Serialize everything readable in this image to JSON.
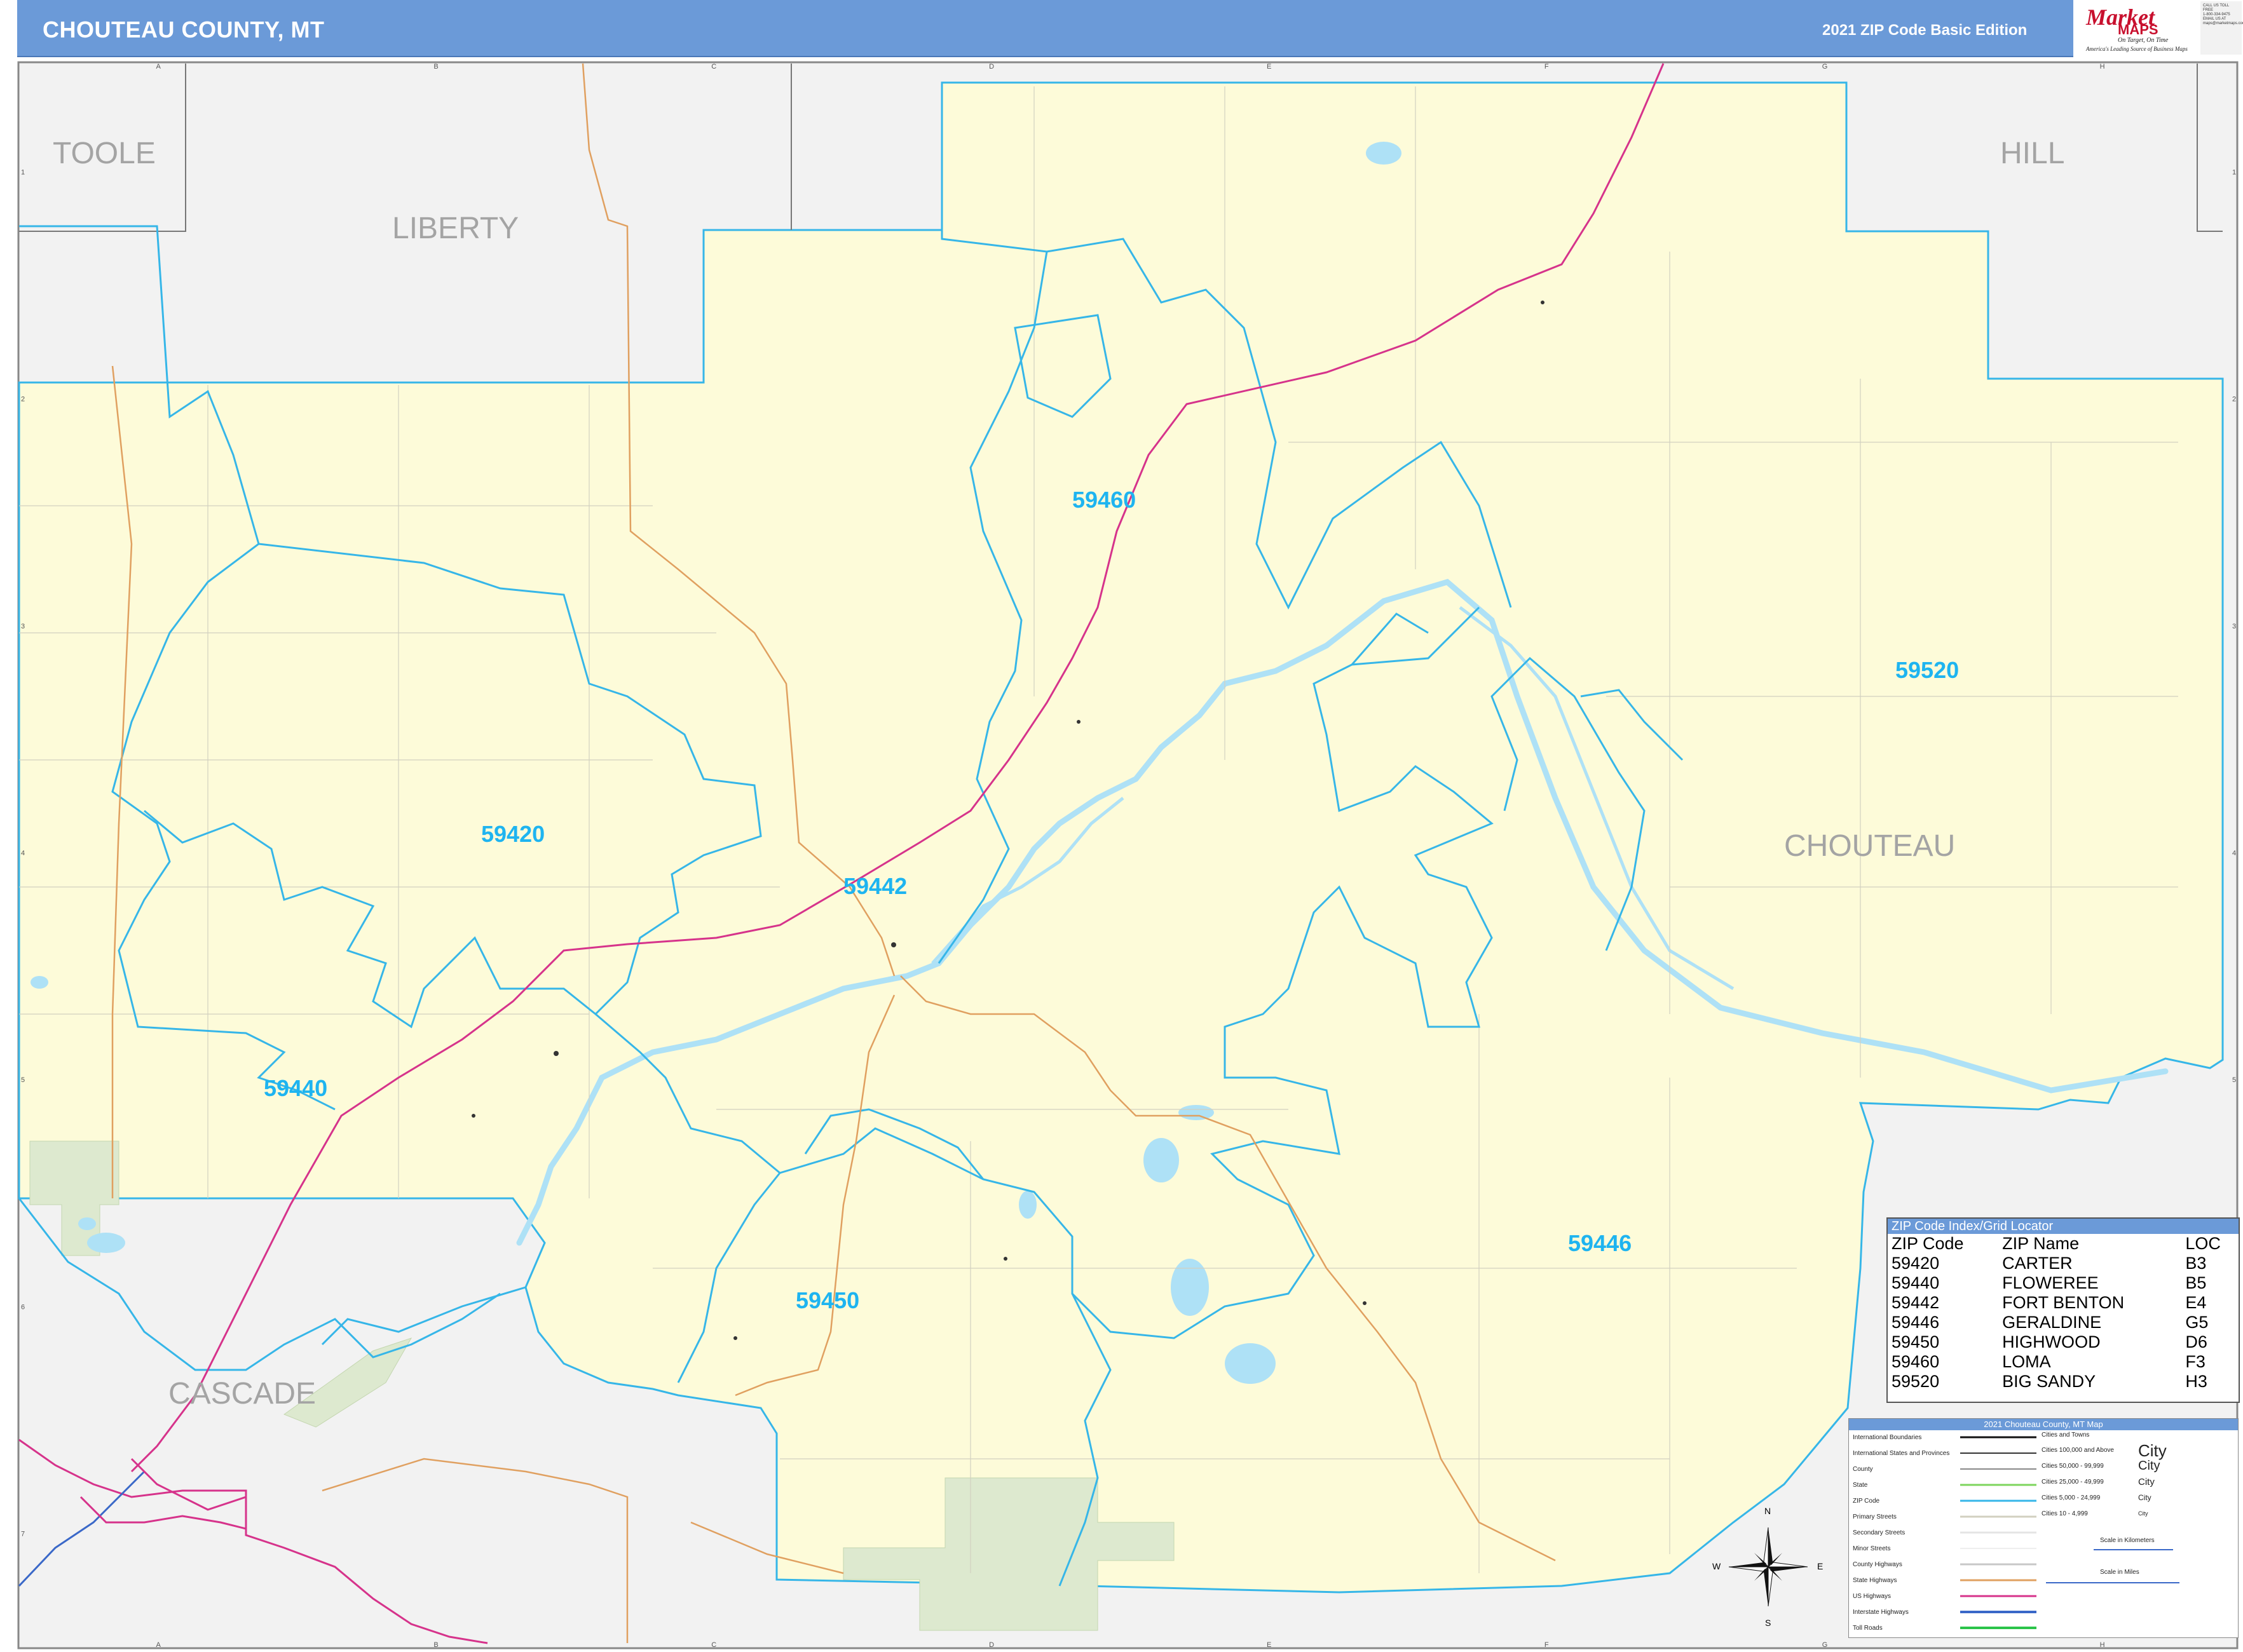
{
  "header": {
    "title": "CHOUTEAU COUNTY, MT",
    "edition": "2021 ZIP Code Basic Edition",
    "logo": {
      "brand_top": "Market",
      "brand_bottom": "MAPS",
      "tagline": "On Target, On Time",
      "tagline2": "America's Leading Source of Business Maps"
    },
    "contact": [
      "CALL US TOLL FREE",
      "1-800-334-9475",
      "EMAIL US AT",
      "maps@marketmaps.com"
    ]
  },
  "grid": {
    "columns": [
      "A",
      "B",
      "C",
      "D",
      "E",
      "F",
      "G",
      "H"
    ],
    "rows": [
      "1",
      "2",
      "3",
      "4",
      "5",
      "6",
      "7"
    ]
  },
  "counties": {
    "toole": "TOOLE",
    "liberty": "LIBERTY",
    "hill": "HILL",
    "chouteau": "CHOUTEAU",
    "cascade": "CASCADE"
  },
  "zip_labels": {
    "z59460": "59460",
    "z59520": "59520",
    "z59420": "59420",
    "z59442": "59442",
    "z59440": "59440",
    "z59446": "59446",
    "z59450": "59450"
  },
  "zip_index": {
    "title": "ZIP Code Index/Grid Locator",
    "headers": [
      "ZIP Code",
      "ZIP Name",
      "LOC"
    ],
    "rows": [
      [
        "59420",
        "CARTER",
        "B3"
      ],
      [
        "59440",
        "FLOWEREE",
        "B5"
      ],
      [
        "59442",
        "FORT BENTON",
        "E4"
      ],
      [
        "59446",
        "GERALDINE",
        "G5"
      ],
      [
        "59450",
        "HIGHWOOD",
        "D6"
      ],
      [
        "59460",
        "LOMA",
        "F3"
      ],
      [
        "59520",
        "BIG SANDY",
        "H3"
      ]
    ]
  },
  "legend": {
    "title": "2021 Chouteau County, MT Map",
    "left_items": [
      "International Boundaries",
      "International States and Provinces",
      "County",
      "State",
      "ZIP Code",
      "Primary Streets",
      "Secondary Streets",
      "Minor Streets",
      "County Highways",
      "State Highways",
      "US Highways",
      "Interstate Highways",
      "Toll Roads"
    ],
    "cities_header": "Cities and Towns",
    "city_items": [
      {
        "label": "Cities 100,000 and Above",
        "sample": "City"
      },
      {
        "label": "Cities 50,000 - 99,999",
        "sample": "City"
      },
      {
        "label": "Cities 25,000 - 49,999",
        "sample": "City"
      },
      {
        "label": "Cities 5,000 - 24,999",
        "sample": "City"
      },
      {
        "label": "Cities 10 - 4,999",
        "sample": "City"
      }
    ],
    "scale_km": "Scale in Kilometers",
    "scale_mi": "Scale in Miles"
  },
  "compass": {
    "n": "N",
    "s": "S",
    "e": "E",
    "w": "W"
  },
  "colors": {
    "header": "#6b9ad8",
    "county_fill": "#fdfbd9",
    "outside_fill": "#f2f2f2",
    "zip_boundary": "#36b6e8",
    "water": "#aee1f6",
    "us_highway": "#d6338b",
    "state_highway": "#e0a060",
    "park": "#dde9cf"
  }
}
